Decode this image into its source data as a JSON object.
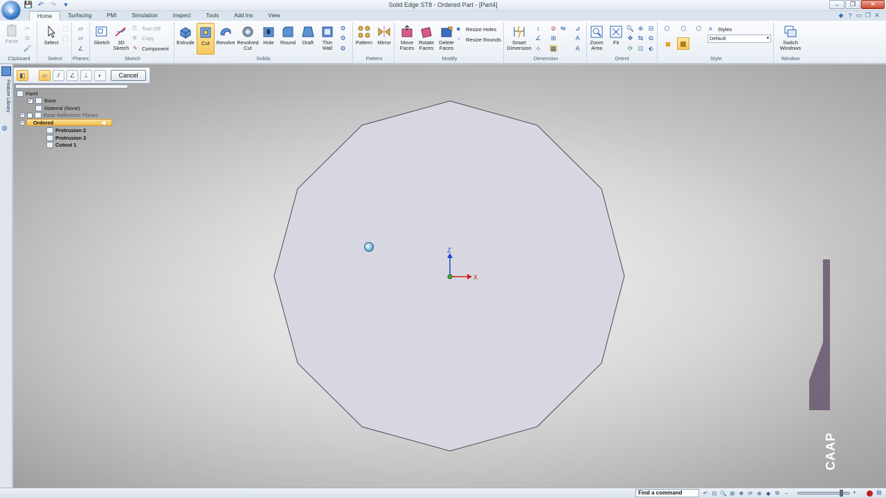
{
  "window": {
    "title": "Solid Edge ST8 - Ordered Part - [Part4]"
  },
  "tabs": [
    "Home",
    "Surfacing",
    "PMI",
    "Simulation",
    "Inspect",
    "Tools",
    "Add Ins",
    "View"
  ],
  "ribbon": {
    "clipboard": {
      "label": "Clipboard",
      "paste": "Paste"
    },
    "select": {
      "label": "Select",
      "select": "Select"
    },
    "planes": {
      "label": "Planes"
    },
    "sketch": {
      "label": "Sketch",
      "sketch": "Sketch",
      "sketch3d_a": "3D",
      "sketch3d_b": "Sketch",
      "tear_off": "Tear-Off",
      "copy": "Copy",
      "component": "Component"
    },
    "solids": {
      "label": "Solids",
      "extrude": "Extrude",
      "cut": "Cut",
      "revolve": "Revolve",
      "revolved_cut_a": "Revolved",
      "revolved_cut_b": "Cut",
      "hole": "Hole",
      "round": "Round",
      "draft": "Draft",
      "thin_wall_a": "Thin",
      "thin_wall_b": "Wall"
    },
    "pattern": {
      "label": "Pattern",
      "pattern": "Pattern",
      "mirror": "Mirror"
    },
    "modify": {
      "label": "Modify",
      "move_faces_a": "Move",
      "move_faces_b": "Faces",
      "rotate_faces_a": "Rotate",
      "rotate_faces_b": "Faces",
      "delete_faces_a": "Delete",
      "delete_faces_b": "Faces",
      "resize_holes": "Resize Holes",
      "resize_rounds": "Resize Rounds"
    },
    "dimension": {
      "label": "Dimension",
      "smart_dimension_a": "Smart",
      "smart_dimension_b": "Dimension"
    },
    "orient": {
      "label": "Orient",
      "zoom_area_a": "Zoom",
      "zoom_area_b": "Area",
      "fit": "Fit"
    },
    "style": {
      "label": "Style",
      "styles": "Styles",
      "default": "Default"
    },
    "window": {
      "label": "Window",
      "switch_windows_a": "Switch",
      "switch_windows_b": "Windows"
    }
  },
  "command_bar": {
    "cancel": "Cancel"
  },
  "side_tab": {
    "feature_library": "Feature Library"
  },
  "tree": {
    "root": "Part4",
    "base": "Base",
    "material": "Material (None)",
    "base_reference_planes": "Base Reference Planes",
    "ordered": "Ordered",
    "features": [
      "Protrusion 2",
      "Protrusion 3",
      "Cutout 1"
    ]
  },
  "viewport": {
    "axis_z": "Z",
    "axis_x": "X"
  },
  "watermark": {
    "brand": "CAAP"
  },
  "status": {
    "find_command": "Find a command"
  },
  "colors": {
    "ribbon_selected": "#f6c85c",
    "axis_z": "#2040d0",
    "axis_x": "#d02020",
    "origin": "#40b040",
    "part_face": "#d6d7e0"
  }
}
